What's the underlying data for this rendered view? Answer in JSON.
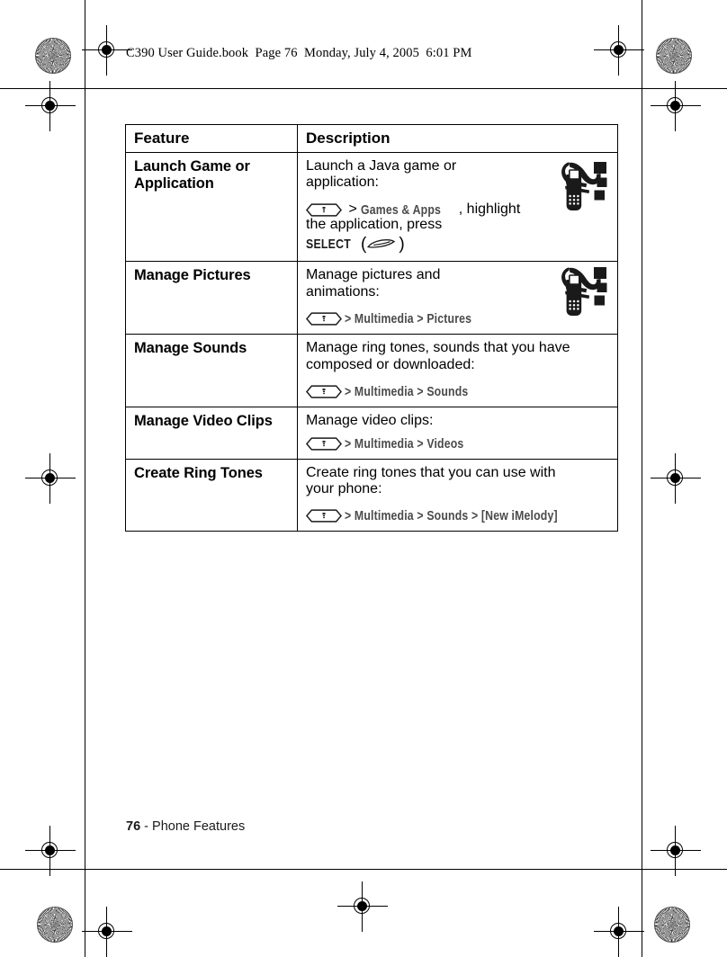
{
  "document": {
    "header_text": "C390 User Guide.book  Page 76  Monday, July 4, 2005  6:01 PM",
    "footer_page_number": "76",
    "footer_separator": " - ",
    "footer_section": "Phone Features"
  },
  "table": {
    "headers": {
      "feature": "Feature",
      "description": "Description"
    },
    "rows": [
      {
        "feature": "Launch Game or Application",
        "desc_lines": [
          "Launch a Java game or",
          "application:"
        ],
        "path": {
          "has_menu_key": true,
          "segments": [
            {
              "text": " > ",
              "style": "plain"
            },
            {
              "text": "Games & Apps",
              "style": "menu"
            },
            {
              "text": ", highlight the application, press ",
              "style": "plain"
            },
            {
              "text": "SELECT",
              "style": "soft"
            },
            {
              "text": " (select-key)",
              "style": "key"
            }
          ],
          "inline_plain_1": ", highlight",
          "inline_plain_2": "the application, press",
          "soft_label": "SELECT"
        },
        "icon": "multimedia-phone-icon"
      },
      {
        "feature": "Manage Pictures",
        "desc_lines": [
          "Manage pictures and",
          "animations:"
        ],
        "path": {
          "has_menu_key": true,
          "text": "> Multimedia > Pictures"
        },
        "icon": "multimedia-phone-icon"
      },
      {
        "feature": "Manage Sounds",
        "desc_lines": [
          "Manage ring tones, sounds that you have",
          "composed or downloaded:"
        ],
        "path": {
          "has_menu_key": true,
          "text": "> Multimedia > Sounds"
        },
        "icon": null
      },
      {
        "feature": "Manage Video Clips",
        "desc_lines": [
          "Manage video clips:"
        ],
        "path": {
          "has_menu_key": true,
          "text": "> Multimedia > Videos"
        },
        "icon": null
      },
      {
        "feature": "Create Ring Tones",
        "desc_lines": [
          "Create ring tones that you can use with",
          "your phone:"
        ],
        "path": {
          "has_menu_key": true,
          "text": "> Multimedia > Sounds > [New iMelody]"
        },
        "icon": null
      }
    ]
  },
  "colors": {
    "text": "#000000",
    "menu_path": "#4a4a4a",
    "rule": "#000000"
  }
}
